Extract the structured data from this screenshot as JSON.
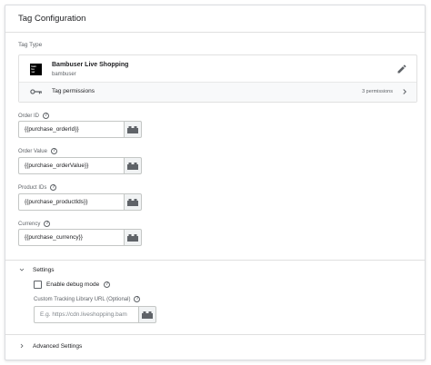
{
  "header": {
    "title": "Tag Configuration"
  },
  "tag_type": {
    "section_label": "Tag Type",
    "name": "Bambuser Live Shopping",
    "vendor": "bambuser",
    "logo_text": [
      "bam",
      "bu",
      "ser"
    ],
    "permissions_label": "Tag permissions",
    "permissions_count": "3 permissions"
  },
  "fields": {
    "order_id": {
      "label": "Order ID",
      "value": "{{purchase_orderId}}"
    },
    "order_value": {
      "label": "Order Value",
      "value": "{{purchase_orderValue}}"
    },
    "product_ids": {
      "label": "Product IDs",
      "value": "{{purchase_productIds}}"
    },
    "currency": {
      "label": "Currency",
      "value": "{{purchase_currency}}"
    }
  },
  "settings": {
    "label": "Settings",
    "debug_label": "Enable debug mode",
    "debug_checked": false,
    "tracking_url_label": "Custom Tracking Library URL (Optional)",
    "tracking_url_placeholder": "E.g. https://cdn.liveshopping.bam"
  },
  "advanced": {
    "label": "Advanced Settings"
  },
  "icons": {
    "help": "help-circle-icon",
    "variable": "variable-brick-icon",
    "edit": "pencil-icon",
    "key": "key-icon",
    "chevron_right": "chevron-right-icon",
    "chevron_down": "chevron-down-icon"
  },
  "colors": {
    "border": "#dadce0",
    "text": "#202124",
    "muted": "#5f6368",
    "variable_bg": "#f1f3f4"
  }
}
